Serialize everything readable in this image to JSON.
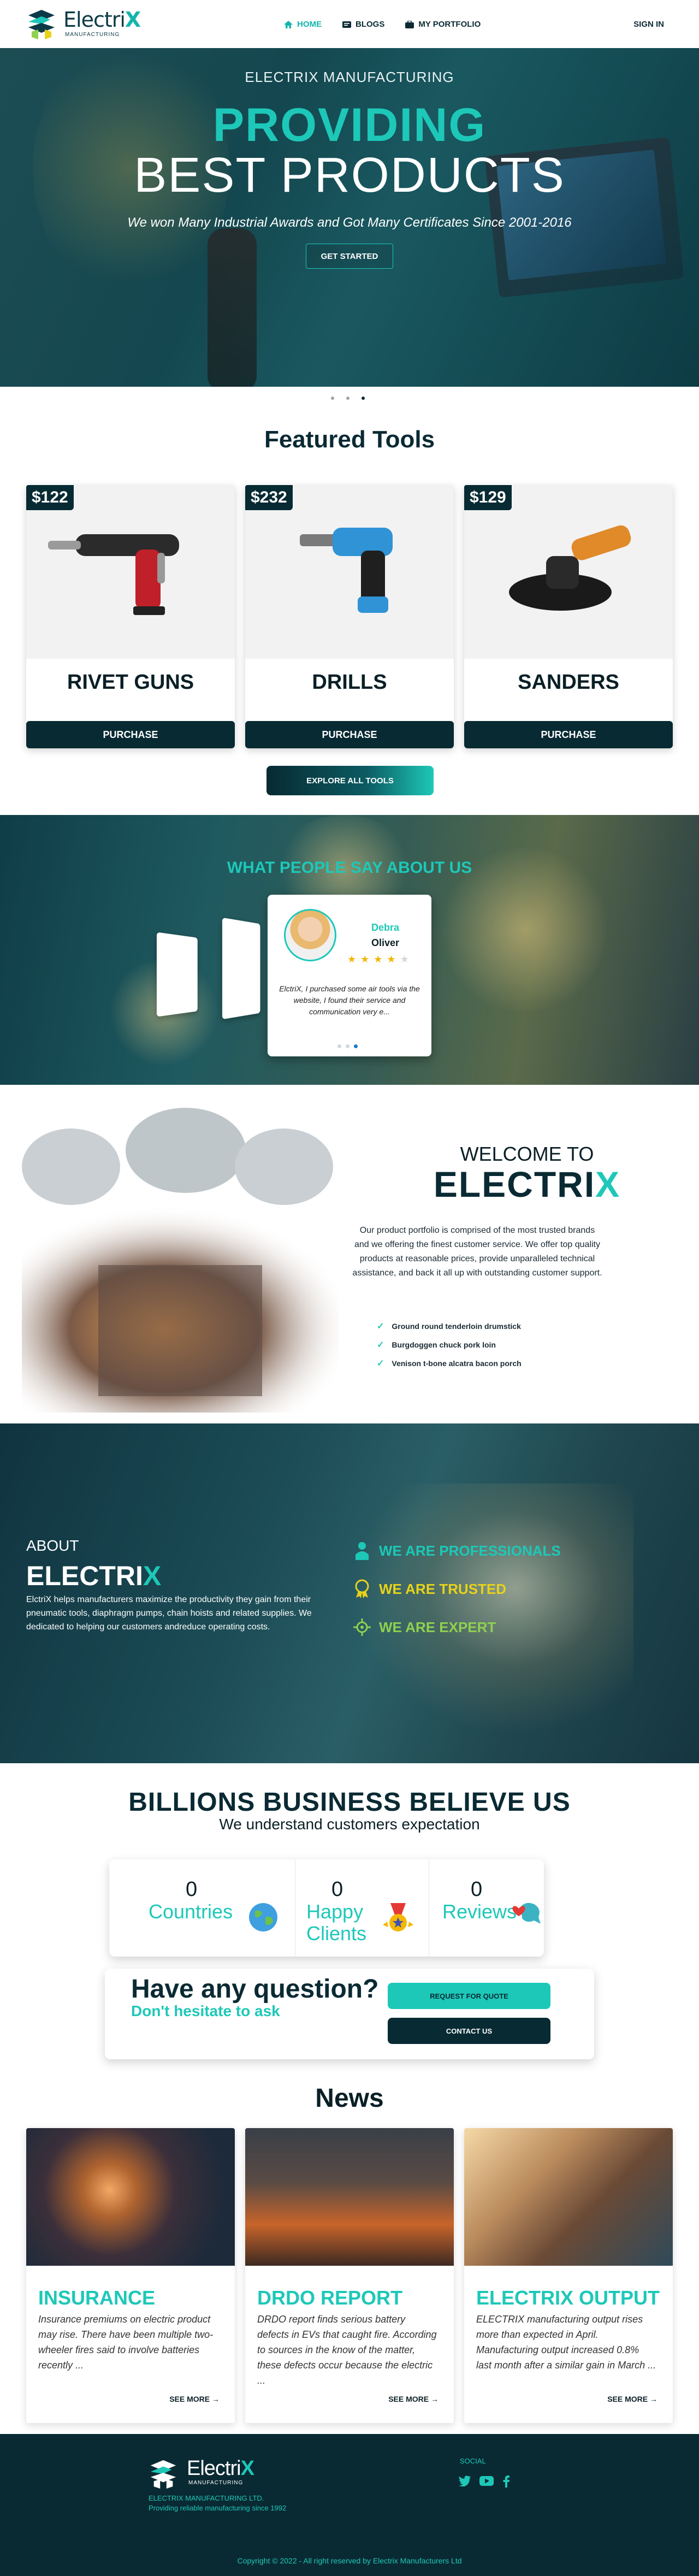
{
  "nav": {
    "logo_main": "Electri",
    "logo_accent": "X",
    "logo_sub": "MANUFACTURING",
    "links": [
      {
        "label": "HOME",
        "icon": "home-icon"
      },
      {
        "label": "BLOGS",
        "icon": "blog-icon"
      },
      {
        "label": "MY PORTFOLIO",
        "icon": "portfolio-icon"
      }
    ],
    "signin": "SIGN IN"
  },
  "hero": {
    "kicker": "ELECTRIX MANUFACTURING",
    "title_line1": "PROVIDING",
    "title_line2": "BEST PRODUCTS",
    "subtitle": "We won Many Industrial Awards and Got Many Certificates Since 2001-2016",
    "cta": "GET STARTED",
    "active_slide": 3,
    "slide_count": 3
  },
  "featured": {
    "title": "Featured Tools",
    "tools": [
      {
        "price": "$122",
        "name": "RIVET GUNS",
        "button": "PURCHASE"
      },
      {
        "price": "$232",
        "name": "DRILLS",
        "button": "PURCHASE"
      },
      {
        "price": "$129",
        "name": "SANDERS",
        "button": "PURCHASE"
      }
    ],
    "explore": "EXPLORE ALL TOOLS"
  },
  "testimonials": {
    "title": "WHAT PEOPLE SAY ABOUT US",
    "active": {
      "first_name": "Debra",
      "last_name": "Oliver",
      "rating": 4,
      "max_rating": 5,
      "quote": "ElctriX, I purchased some air tools via the website, I found their service and communication very e..."
    },
    "active_dot": 3,
    "dot_count": 3
  },
  "welcome": {
    "title_line1": "WELCOME TO",
    "title_main": "ELECTRI",
    "title_accent": "X",
    "text": "Our product portfolio is comprised of the most trusted brands and we offering the finest customer service. We offer top quality products at reasonable prices, provide unparalleled technical assistance, and back it all up with outstanding customer support.",
    "checks": [
      "Ground round tenderloin drumstick",
      "Burgdoggen chuck pork loin",
      "Venison t-bone alcatra bacon porch"
    ]
  },
  "about": {
    "heading": "ABOUT",
    "brand_main": "ELECTRI",
    "brand_accent": "X",
    "text": "ElctriX helps manufacturers maximize the productivity they gain from their pneumatic tools, diaphragm pumps, chain hoists and related supplies. We dedicated to helping our customers andreduce operating costs.",
    "badges": [
      {
        "label": "WE ARE PROFESSIONALS",
        "color": "#1dc8b8",
        "icon": "person-icon"
      },
      {
        "label": "WE ARE TRUSTED",
        "color": "#e8d21a",
        "icon": "medal-icon"
      },
      {
        "label": "WE ARE EXPERT",
        "color": "#8fd14f",
        "icon": "expert-icon"
      }
    ]
  },
  "billions": {
    "title": "BILLIONS BUSINESS BELIEVE US",
    "subtitle": "We understand customers expectation",
    "stats": [
      {
        "value": "0",
        "label": "Countries",
        "icon": "globe-icon"
      },
      {
        "value": "0",
        "label": "Happy Clients",
        "icon": "award-icon"
      },
      {
        "value": "0",
        "label": "Reviews",
        "icon": "chat-heart-icon"
      }
    ]
  },
  "question": {
    "title": "Have any question?",
    "subtitle": "Don't hesitate to ask",
    "quote_button": "REQUEST FOR QUOTE",
    "contact_button": "CONTACT US"
  },
  "news": {
    "title": "News",
    "items": [
      {
        "title": "INSURANCE",
        "text": "Insurance premiums on electric product may rise. There have been multiple two-wheeler fires said to involve batteries recently ...",
        "more": "SEE MORE"
      },
      {
        "title": "DRDO REPORT",
        "text": "DRDO report finds serious battery defects in EVs that caught fire. According to sources in the know of the matter, these defects occur because the electric ...",
        "more": "SEE MORE"
      },
      {
        "title": "ELECTRIX OUTPUT",
        "text": "ELECTRIX manufacturing output rises more than expected in April. Manufacturing output increased 0.8% last month after a similar gain in March ...",
        "more": "SEE MORE"
      }
    ]
  },
  "footer": {
    "logo_main": "Electri",
    "logo_accent": "X",
    "logo_sub": "MANUFACTURING",
    "company": "ELECTRIX MANUFACTURING LTD.",
    "tagline": "Providing reliable manufacturing since 1992",
    "social_label": "SOCIAL",
    "social_icons": [
      "twitter-icon",
      "youtube-icon",
      "facebook-icon"
    ],
    "copyright": "Copyright © 2022 - All right reserved by Electrix Manufacturers Ltd"
  }
}
